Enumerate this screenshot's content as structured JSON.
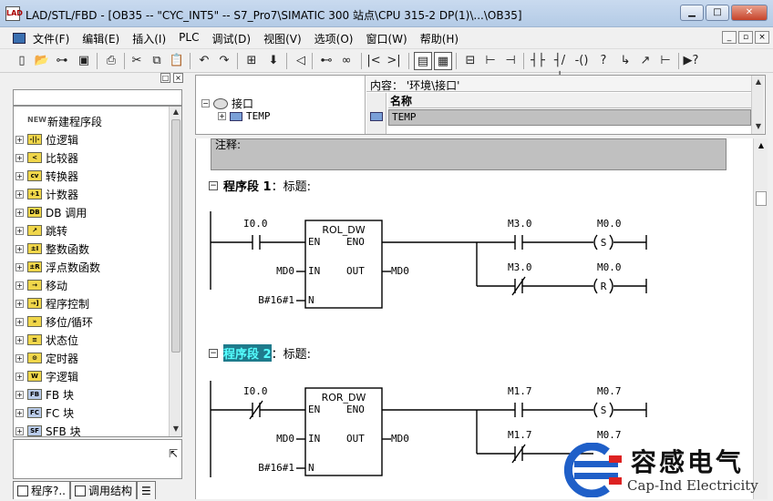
{
  "window": {
    "title": "LAD/STL/FBD  - [OB35 -- \"CYC_INT5\" -- S7_Pro7\\SIMATIC 300 站点\\CPU 315-2 DP(1)\\...\\OB35]",
    "app_icon": "LAD"
  },
  "menu": [
    "文件(F)",
    "编辑(E)",
    "插入(I)",
    "PLC",
    "调试(D)",
    "视图(V)",
    "选项(O)",
    "窗口(W)",
    "帮助(H)"
  ],
  "catalog": {
    "items": [
      {
        "label": "新建程序段",
        "icon": "NEW"
      },
      {
        "label": "位逻辑",
        "icon": "-||-"
      },
      {
        "label": "比较器",
        "icon": "<"
      },
      {
        "label": "转换器",
        "icon": "cv"
      },
      {
        "label": "计数器",
        "icon": "+1"
      },
      {
        "label": "DB 调用",
        "icon": "DB"
      },
      {
        "label": "跳转",
        "icon": "↗"
      },
      {
        "label": "整数函数",
        "icon": "±I"
      },
      {
        "label": "浮点数函数",
        "icon": "±R"
      },
      {
        "label": "移动",
        "icon": "→"
      },
      {
        "label": "程序控制",
        "icon": "→]"
      },
      {
        "label": "移位/循环",
        "icon": "»"
      },
      {
        "label": "状态位",
        "icon": "≡"
      },
      {
        "label": "定时器",
        "icon": "⊙"
      },
      {
        "label": "字逻辑",
        "icon": "W"
      },
      {
        "label": "FB 块",
        "icon": "FB"
      },
      {
        "label": "FC 块",
        "icon": "FC"
      },
      {
        "label": "SFB 块",
        "icon": "SF"
      }
    ],
    "tabs": [
      "程序?..",
      "调用结构",
      "☰"
    ]
  },
  "interface": {
    "root": "接口",
    "child": "TEMP",
    "content_header": "内容： '环境\\接口'",
    "column_name": "名称",
    "row_value": "TEMP"
  },
  "editor": {
    "comment_label": "注释:",
    "networks": [
      {
        "prefix": "程序段",
        "number": "1",
        "title_label": "：标题:",
        "block": "ROL_DW",
        "in_contact": "I0.0",
        "en": "EN",
        "eno": "ENO",
        "in_label": "IN",
        "out_label": "OUT",
        "n_label": "N",
        "in_val": "MD0",
        "out_val": "MD0",
        "n_val": "B#16#1",
        "out1_contact": "M3.0",
        "out1_coil_addr": "M0.0",
        "out1_coil": "S",
        "out2_contact": "M3.0",
        "out2_coil_addr": "M0.0",
        "out2_coil": "R"
      },
      {
        "prefix": "程序段",
        "number": "2",
        "title_label": "：标题:",
        "block": "ROR_DW",
        "in_contact": "I0.0",
        "en": "EN",
        "eno": "ENO",
        "in_label": "IN",
        "out_label": "OUT",
        "n_label": "N",
        "in_val": "MD0",
        "out_val": "MD0",
        "n_val": "B#16#1",
        "out1_contact": "M1.7",
        "out1_coil_addr": "M0.7",
        "out1_coil": "S",
        "out2_contact": "M1.7",
        "out2_coil_addr": "M0.7",
        "out2_coil": ""
      }
    ]
  },
  "watermark": {
    "cn": "容感电气",
    "en": "Cap-Ind Electricity",
    "color": "#1f5fc8"
  }
}
